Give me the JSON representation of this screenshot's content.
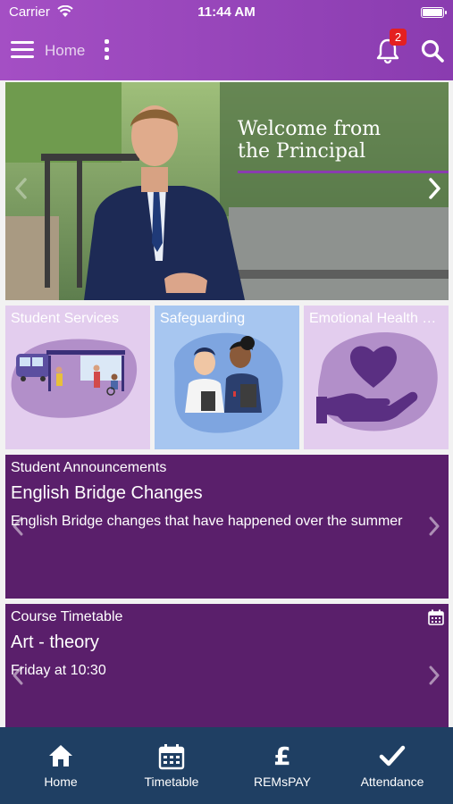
{
  "status_bar": {
    "carrier": "Carrier",
    "time": "11:44 AM"
  },
  "header": {
    "title": "Home",
    "notification_count": "2"
  },
  "hero": {
    "title_line1": "Welcome from",
    "title_line2": "the Principal"
  },
  "tiles": [
    {
      "label": "Student Services"
    },
    {
      "label": "Safeguarding"
    },
    {
      "label": "Emotional Health & Wellbeing"
    }
  ],
  "announcements": {
    "section": "Student Announcements",
    "headline": "English Bridge Changes",
    "summary": "English Bridge changes that have happened over the summer"
  },
  "timetable": {
    "section": "Course Timetable",
    "headline": "Art - theory",
    "summary": "Friday at 10:30"
  },
  "tabbar": {
    "items": [
      {
        "label": "Home",
        "icon": "home-icon"
      },
      {
        "label": "Timetable",
        "icon": "calendar-icon"
      },
      {
        "label": "REMsPAY",
        "icon": "pound-icon"
      },
      {
        "label": "Attendance",
        "icon": "checkmark-icon"
      }
    ]
  },
  "colors": {
    "header": "#9a46bc",
    "card": "#5a1f6b",
    "tabbar": "#1f3f63",
    "tile_lilac": "#e3cdee",
    "tile_blue": "#a7c6f0",
    "badge": "#e42020"
  }
}
